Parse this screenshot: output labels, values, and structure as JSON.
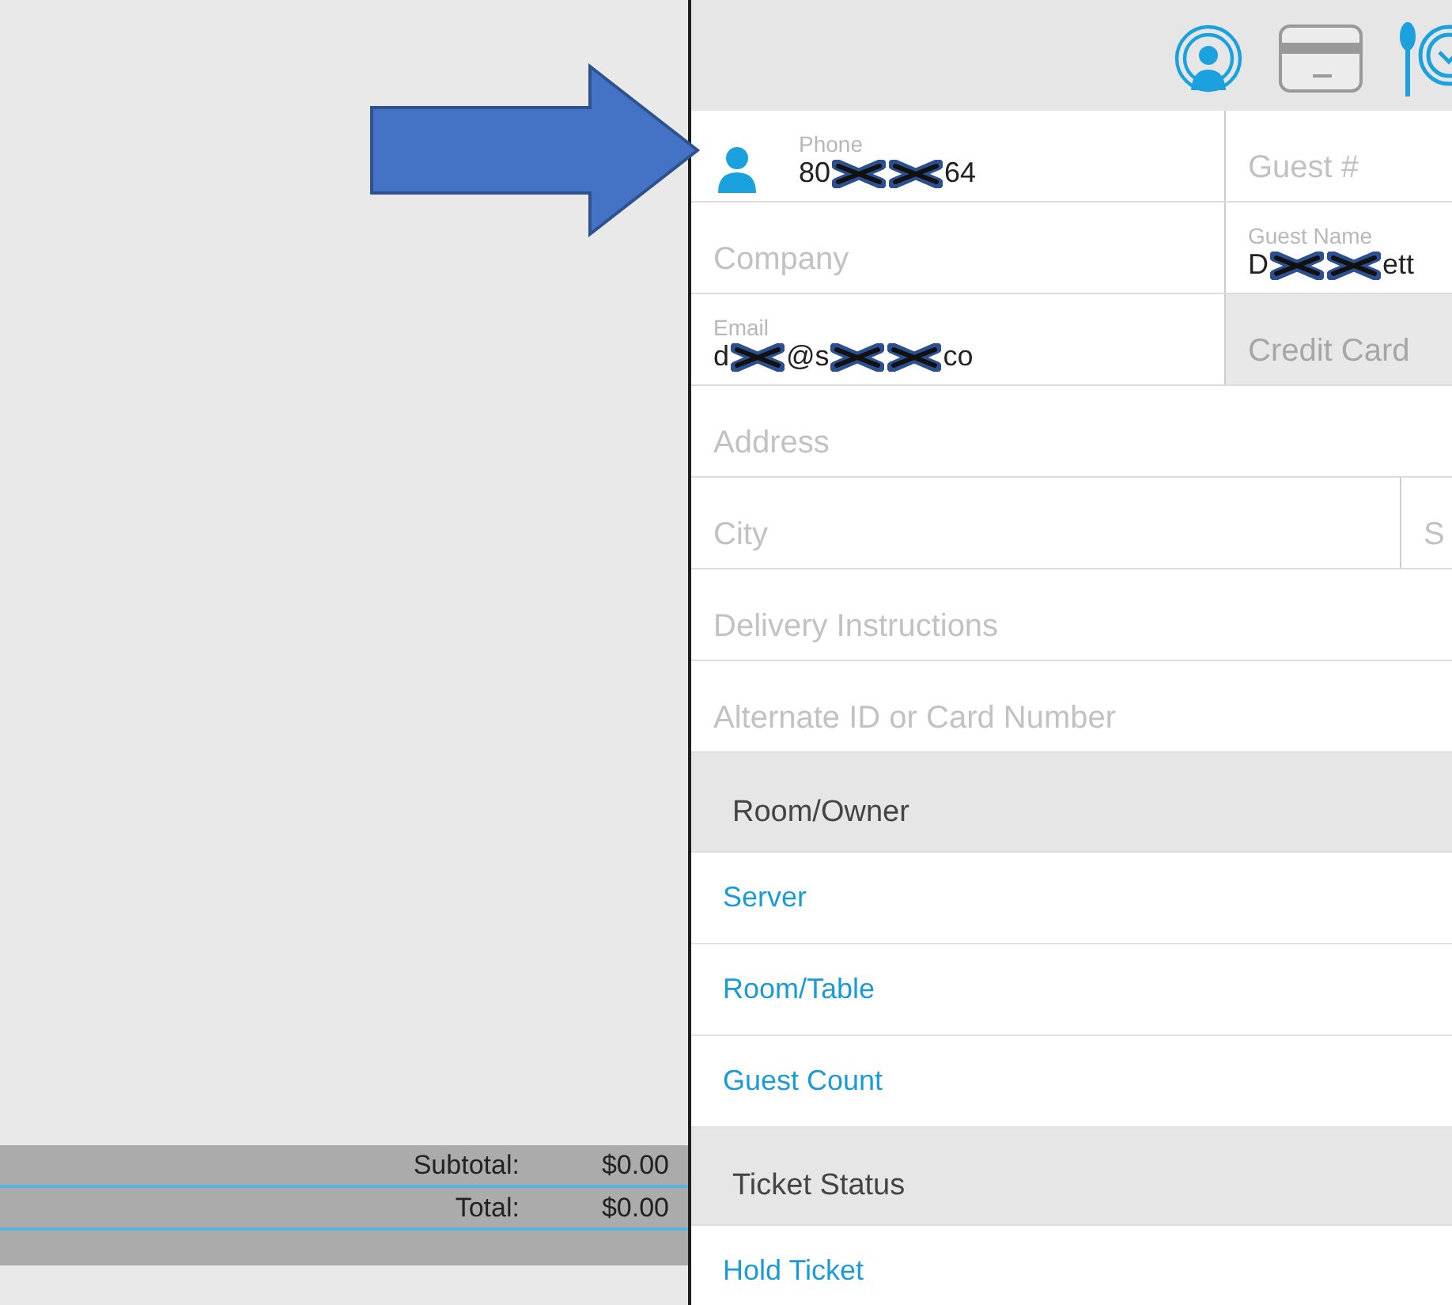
{
  "totals": [
    {
      "label": "Subtotal:",
      "value": "$0.00"
    },
    {
      "label": "Total:",
      "value": "$0.00"
    }
  ],
  "form_rows": [
    {
      "kind": "pair",
      "cells": [
        {
          "kind": "filled",
          "label": "Phone",
          "parts": [
            {
              "kind": "text",
              "text": "80"
            },
            {
              "kind": "redaction"
            },
            {
              "kind": "redaction"
            },
            {
              "kind": "text",
              "text": "64"
            }
          ]
        },
        {
          "kind": "empty",
          "placeholder": "Guest #",
          "disabled": false
        }
      ]
    },
    {
      "kind": "pair",
      "cells": [
        {
          "kind": "empty",
          "placeholder": "Company",
          "disabled": false
        },
        {
          "kind": "filled",
          "label": "Guest Name",
          "parts": [
            {
              "kind": "text",
              "text": "D"
            },
            {
              "kind": "redaction"
            },
            {
              "kind": "redaction"
            },
            {
              "kind": "text",
              "text": "ett"
            }
          ]
        }
      ]
    },
    {
      "kind": "pair",
      "cells": [
        {
          "kind": "filled",
          "label": "Email",
          "parts": [
            {
              "kind": "text",
              "text": "d"
            },
            {
              "kind": "redaction"
            },
            {
              "kind": "text",
              "text": "@s"
            },
            {
              "kind": "redaction"
            },
            {
              "kind": "redaction"
            },
            {
              "kind": "text",
              "text": "co"
            }
          ]
        },
        {
          "kind": "empty",
          "placeholder": "Credit Card",
          "disabled": true
        }
      ]
    },
    {
      "kind": "single",
      "cells": [
        {
          "kind": "empty",
          "placeholder": "Address",
          "disabled": false
        }
      ]
    },
    {
      "kind": "split-end",
      "cells": [
        {
          "kind": "empty",
          "placeholder": "City",
          "disabled": false
        },
        {
          "kind": "empty",
          "placeholder": "S",
          "disabled": false
        }
      ]
    },
    {
      "kind": "single",
      "cells": [
        {
          "kind": "empty",
          "placeholder": "Delivery Instructions",
          "disabled": false
        }
      ]
    },
    {
      "kind": "single",
      "cells": [
        {
          "kind": "empty",
          "placeholder": "Alternate ID or Card Number",
          "disabled": false
        }
      ]
    }
  ],
  "sections": [
    {
      "title": "Room/Owner",
      "items": [
        "Server",
        "Room/Table",
        "Guest Count"
      ]
    },
    {
      "title": "Ticket Status",
      "items": [
        "Hold Ticket"
      ]
    }
  ]
}
